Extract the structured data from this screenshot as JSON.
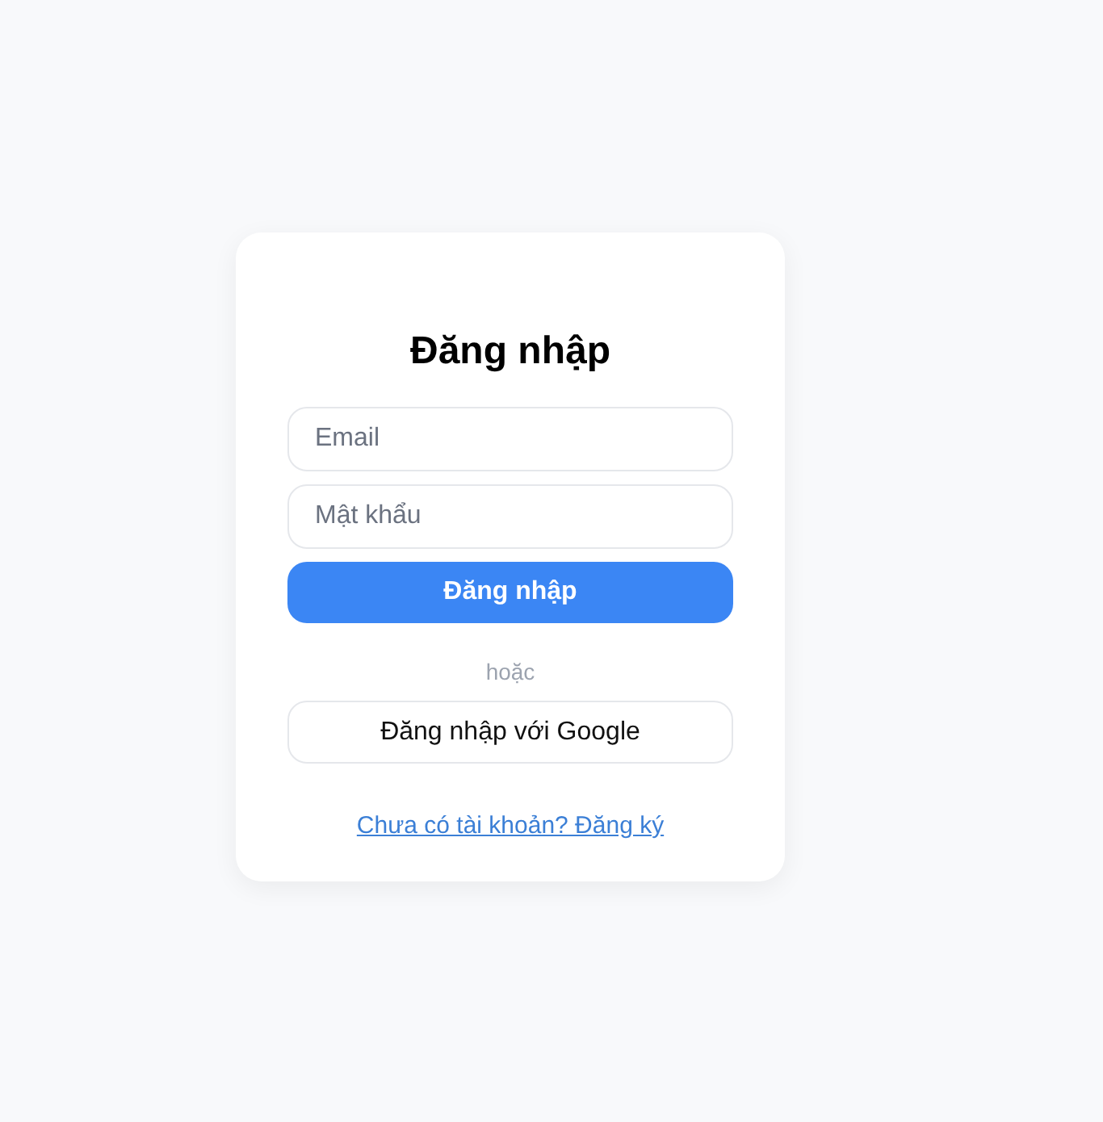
{
  "title": "Đăng nhập",
  "fields": [
    {
      "placeholder": "Email"
    },
    {
      "placeholder": "Mật khẩu"
    }
  ],
  "submit": "Đăng nhập",
  "divider": "hoặc",
  "google_button": "Đăng nhập với Google",
  "signup_link": "Chưa có tài khoản? Đăng ký"
}
